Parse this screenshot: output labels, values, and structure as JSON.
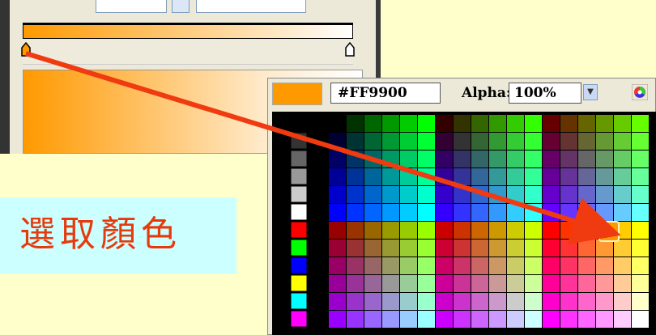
{
  "label": {
    "text": "選取顏色"
  },
  "picker": {
    "hex_value": "#FF9900",
    "alpha_label": "Alpha:",
    "alpha_value": "100%",
    "selected_color": "#FF9900"
  },
  "colors": {
    "background": "#FFFFCC",
    "label_box": "#CCFFFF",
    "label_text": "#E63A0D",
    "arrow": "#F03A10",
    "gradient_start": "#FF9900",
    "gradient_end": "#FFFFFF"
  },
  "icons": [
    "color-wheel-icon",
    "chevron-down-icon",
    "gradient-stop-marker"
  ]
}
